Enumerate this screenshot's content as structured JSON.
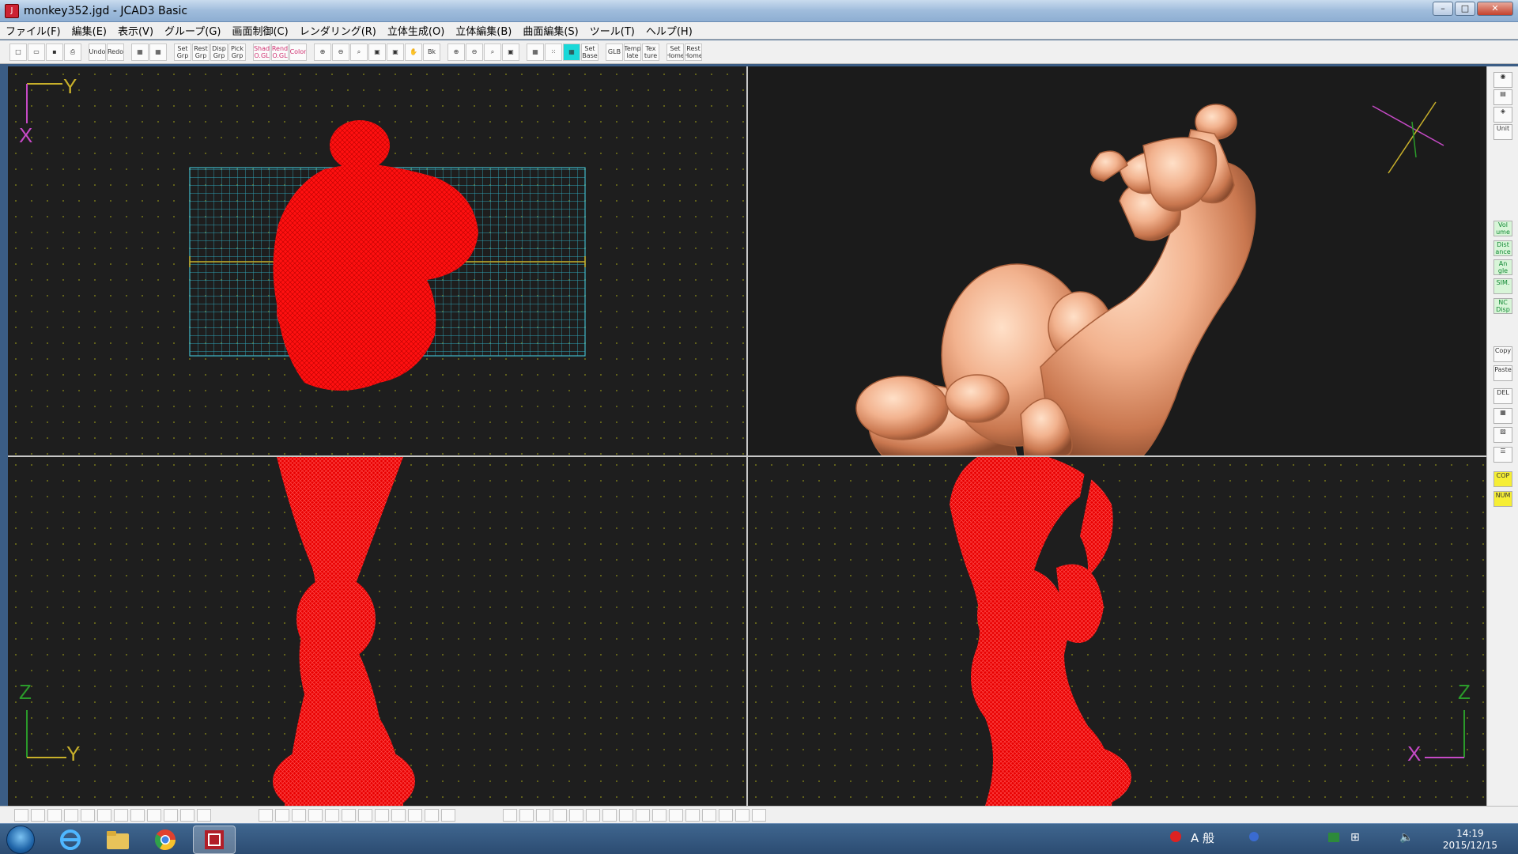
{
  "window": {
    "title": "monkey352.jgd - JCAD3 Basic",
    "minimize": "–",
    "maximize": "□",
    "close": "✕"
  },
  "menu": {
    "items": [
      "ファイル(F)",
      "編集(E)",
      "表示(V)",
      "グループ(G)",
      "画面制御(C)",
      "レンダリング(R)",
      "立体生成(O)",
      "立体編集(B)",
      "曲面編集(S)",
      "ツール(T)",
      "ヘルプ(H)"
    ]
  },
  "toolbar": {
    "groups": [
      [
        {
          "name": "new-file",
          "label": "",
          "icon": "□"
        },
        {
          "name": "open-file",
          "label": "",
          "icon": "▭"
        },
        {
          "name": "save-file",
          "label": "",
          "icon": "▪"
        },
        {
          "name": "print",
          "label": "",
          "icon": "⎙"
        }
      ],
      [
        {
          "name": "undo",
          "label": "Undo",
          "icon": ""
        },
        {
          "name": "redo",
          "label": "Redo",
          "icon": ""
        }
      ],
      [
        {
          "name": "group-a",
          "label": "",
          "icon": "▦"
        },
        {
          "name": "group-b",
          "label": "",
          "icon": "▦"
        }
      ],
      [
        {
          "name": "set-grp",
          "label": "Set Grp",
          "icon": ""
        },
        {
          "name": "rest-grp",
          "label": "Rest Grp",
          "icon": ""
        },
        {
          "name": "disp-grp",
          "label": "Disp Grp",
          "icon": ""
        },
        {
          "name": "pick-grp",
          "label": "Pick Grp",
          "icon": ""
        }
      ],
      [
        {
          "name": "shad-ogl",
          "label": "Shad O.GL",
          "icon": "",
          "pink": true
        },
        {
          "name": "rend-ogl",
          "label": "Rend O.GL",
          "icon": "",
          "pink": true
        },
        {
          "name": "color",
          "label": "Color",
          "icon": "",
          "pink": true
        }
      ],
      [
        {
          "name": "zoom-in",
          "label": "",
          "icon": "⊕"
        },
        {
          "name": "zoom-out",
          "label": "",
          "icon": "⊖"
        },
        {
          "name": "zoom-fit",
          "label": "",
          "icon": "⌕"
        },
        {
          "name": "view-a",
          "label": "",
          "icon": "▣"
        },
        {
          "name": "view-b",
          "label": "",
          "icon": "▣"
        },
        {
          "name": "pan",
          "label": "",
          "icon": "✋"
        },
        {
          "name": "back",
          "label": "Bk",
          "icon": ""
        }
      ],
      [
        {
          "name": "zoom-red-1",
          "label": "",
          "icon": "⊕"
        },
        {
          "name": "zoom-red-2",
          "label": "",
          "icon": "⊖"
        },
        {
          "name": "zoom-red-3",
          "label": "",
          "icon": "⌕"
        },
        {
          "name": "zoom-red-4",
          "label": "",
          "icon": "▣"
        }
      ],
      [
        {
          "name": "grid",
          "label": "",
          "icon": "▦"
        },
        {
          "name": "snap",
          "label": "",
          "icon": "⁙"
        },
        {
          "name": "active-grid",
          "label": "",
          "icon": "▦",
          "cyan": true
        },
        {
          "name": "set-base",
          "label": "Set Base",
          "icon": ""
        }
      ],
      [
        {
          "name": "glb",
          "label": "GLB",
          "icon": ""
        },
        {
          "name": "template",
          "label": "Temp late",
          "icon": ""
        },
        {
          "name": "texture",
          "label": "Tex ture",
          "icon": ""
        }
      ],
      [
        {
          "name": "set-home",
          "label": "Set Home",
          "icon": ""
        },
        {
          "name": "rest-home",
          "label": "Rest Home",
          "icon": ""
        }
      ]
    ]
  },
  "viewports": {
    "top_left": {
      "axis_h": "Y",
      "axis_v": "X"
    },
    "bottom_left": {
      "axis_v": "Z",
      "axis_h": "Y"
    },
    "bottom_right": {
      "axis_v": "Z",
      "axis_h": "X"
    }
  },
  "right_toolbar": {
    "items": [
      {
        "name": "rt-eye",
        "label": "◉",
        "kind": "plain"
      },
      {
        "name": "rt-disp",
        "label": "▤",
        "kind": "plain"
      },
      {
        "name": "rt-layer",
        "label": "◈",
        "kind": "plain"
      },
      {
        "name": "rt-unit",
        "label": "Unit",
        "kind": "plain"
      },
      {
        "name": "rt-volume",
        "label": "Vol ume",
        "kind": "green"
      },
      {
        "name": "rt-distance",
        "label": "Dist ance",
        "kind": "green"
      },
      {
        "name": "rt-angle",
        "label": "An gle",
        "kind": "green"
      },
      {
        "name": "rt-sim",
        "label": "SIM.",
        "kind": "green"
      },
      {
        "name": "rt-nc-disp",
        "label": "NC Disp",
        "kind": "green"
      },
      {
        "name": "rt-copy",
        "label": "Copy",
        "kind": "plain"
      },
      {
        "name": "rt-paste",
        "label": "Paste",
        "kind": "plain"
      },
      {
        "name": "rt-del",
        "label": "DEL",
        "kind": "plain"
      },
      {
        "name": "rt-grid",
        "label": "▦",
        "kind": "plain"
      },
      {
        "name": "rt-img",
        "label": "▨",
        "kind": "plain"
      },
      {
        "name": "rt-tree",
        "label": "☰",
        "kind": "plain"
      },
      {
        "name": "rt-cop",
        "label": "COP",
        "kind": "yellow"
      },
      {
        "name": "rt-num",
        "label": "NUM",
        "kind": "yellow"
      }
    ]
  },
  "taskbar": {
    "tasks": [
      "Internet Explorer",
      "Explorer",
      "Chrome",
      "JCAD3"
    ],
    "tray_text": "A 般",
    "time": "14:19",
    "date": "2015/12/15"
  }
}
